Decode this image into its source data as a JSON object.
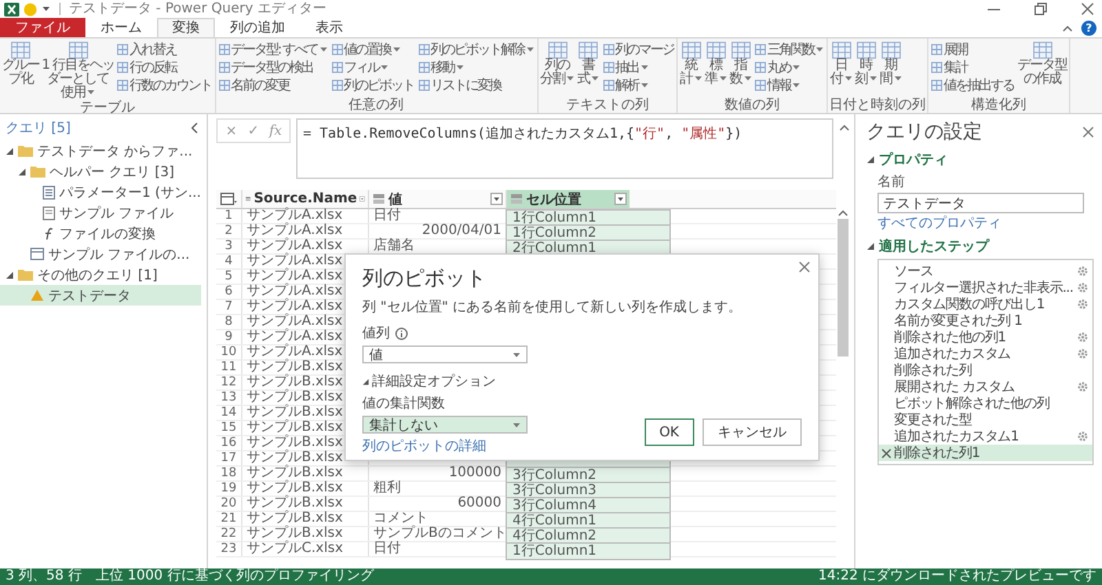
{
  "window": {
    "title": "テストデータ - Power Query エディター"
  },
  "tabs": [
    {
      "label": "ファイル",
      "kind": "file",
      "selected": false
    },
    {
      "label": "ホーム",
      "kind": "tab",
      "selected": false
    },
    {
      "label": "変換",
      "kind": "tab",
      "selected": true
    },
    {
      "label": "列の追加",
      "kind": "tab",
      "selected": false
    },
    {
      "label": "表示",
      "kind": "tab",
      "selected": false
    }
  ],
  "help": "?",
  "ribbon": {
    "groups": [
      {
        "label": "テーブル",
        "items": [
          {
            "kind": "large",
            "label": "グループ化",
            "menu": false
          },
          {
            "kind": "large",
            "label": "1 行目をヘッダーとして使用",
            "menu": true
          },
          {
            "kind": "stack",
            "items": [
              {
                "label": "入れ替え",
                "menu": false
              },
              {
                "label": "行の反転",
                "menu": false
              },
              {
                "label": "行数のカウント",
                "menu": false
              }
            ]
          }
        ]
      },
      {
        "label": "任意の列",
        "items": [
          {
            "kind": "stack",
            "items": [
              {
                "label": "データ型: すべて",
                "menu": true
              },
              {
                "label": "データ型の検出",
                "menu": false
              },
              {
                "label": "名前の変更",
                "menu": false
              }
            ]
          },
          {
            "kind": "stack",
            "items": [
              {
                "label": "値の置換",
                "menu": true
              },
              {
                "label": "フィル",
                "menu": true
              },
              {
                "label": "列のピボット",
                "menu": false
              }
            ]
          },
          {
            "kind": "stack",
            "items": [
              {
                "label": "列のピボット解除",
                "menu": true
              },
              {
                "label": "移動",
                "menu": true
              },
              {
                "label": "リストに変換",
                "menu": false
              }
            ]
          }
        ]
      },
      {
        "label": "テキストの列",
        "items": [
          {
            "kind": "large",
            "label": "列の分割",
            "menu": true
          },
          {
            "kind": "large",
            "label": "書式",
            "menu": true
          },
          {
            "kind": "stack",
            "items": [
              {
                "label": "列のマージ",
                "menu": false
              },
              {
                "label": "抽出",
                "menu": true
              },
              {
                "label": "解析",
                "menu": true
              }
            ]
          }
        ]
      },
      {
        "label": "数値の列",
        "items": [
          {
            "kind": "large",
            "label": "統計",
            "menu": true
          },
          {
            "kind": "large",
            "label": "標準",
            "menu": true
          },
          {
            "kind": "large",
            "label": "指数",
            "menu": true
          },
          {
            "kind": "stack",
            "items": [
              {
                "label": "三角関数",
                "menu": true
              },
              {
                "label": "丸め",
                "menu": true
              },
              {
                "label": "情報",
                "menu": true
              }
            ]
          }
        ]
      },
      {
        "label": "日付と時刻の列",
        "items": [
          {
            "kind": "large",
            "label": "日付",
            "menu": true
          },
          {
            "kind": "large",
            "label": "時刻",
            "menu": true
          },
          {
            "kind": "large",
            "label": "期間",
            "menu": true
          }
        ]
      },
      {
        "label": "構造化列",
        "items": [
          {
            "kind": "stack",
            "items": [
              {
                "label": "展開",
                "menu": false
              },
              {
                "label": "集計",
                "menu": false
              },
              {
                "label": "値を抽出する",
                "menu": false
              }
            ]
          },
          {
            "kind": "large",
            "label": "データ型の作成",
            "menu": false
          }
        ]
      }
    ]
  },
  "queries": {
    "title": "クエリ [5]",
    "tree": [
      {
        "label": "テストデータ からファ...",
        "kind": "folder",
        "expanded": true,
        "selected": false,
        "children": [
          {
            "label": "ヘルパー クエリ [3]",
            "kind": "folder",
            "expanded": true,
            "selected": false,
            "children": [
              {
                "label": "パラメーター1 (サン...",
                "kind": "parameter",
                "selected": false
              },
              {
                "label": "サンプル ファイル",
                "kind": "file",
                "selected": false
              },
              {
                "label": "ファイルの変換",
                "kind": "function",
                "selected": false
              }
            ]
          },
          {
            "label": "サンプル ファイルの...",
            "kind": "table",
            "selected": false
          }
        ]
      },
      {
        "label": "その他のクエリ [1]",
        "kind": "folder",
        "expanded": true,
        "selected": false,
        "children": [
          {
            "label": "テストデータ",
            "kind": "warning",
            "selected": true
          }
        ]
      }
    ]
  },
  "formula_bar": {
    "buttons": [
      "×",
      "✓",
      "fx"
    ],
    "tokens": [
      {
        "kind": "code",
        "text": "= Table.RemoveColumns(追加されたカスタム1,{"
      },
      {
        "kind": "string",
        "text": "\"行\""
      },
      {
        "kind": "code",
        "text": ", "
      },
      {
        "kind": "string",
        "text": "\"属性\""
      },
      {
        "kind": "code",
        "text": "})"
      }
    ]
  },
  "table": {
    "columns": [
      {
        "name": "Source.Name",
        "selected": false
      },
      {
        "name": "値",
        "selected": false
      },
      {
        "name": "セル位置",
        "selected": true
      }
    ],
    "rows": [
      {
        "n": "1",
        "source": "サンプルA.xlsx",
        "value": {
          "text": "日付",
          "kind": "text"
        },
        "cell": "1行Column1"
      },
      {
        "n": "2",
        "source": "サンプルA.xlsx",
        "value": {
          "text": "2000/04/01",
          "kind": "number"
        },
        "cell": "1行Column2"
      },
      {
        "n": "3",
        "source": "サンプルA.xlsx",
        "value": {
          "text": "店舗名",
          "kind": "text"
        },
        "cell": "2行Column1"
      },
      {
        "n": "4",
        "source": "サンプルA.xlsx"
      },
      {
        "n": "5",
        "source": "サンプルA.xlsx"
      },
      {
        "n": "6",
        "source": "サンプルA.xlsx"
      },
      {
        "n": "7",
        "source": "サンプルA.xlsx"
      },
      {
        "n": "8",
        "source": "サンプルA.xlsx"
      },
      {
        "n": "9",
        "source": "サンプルA.xlsx"
      },
      {
        "n": "10",
        "source": "サンプルA.xlsx"
      },
      {
        "n": "11",
        "source": "サンプルB.xlsx"
      },
      {
        "n": "12",
        "source": "サンプルB.xlsx"
      },
      {
        "n": "13",
        "source": "サンプルB.xlsx"
      },
      {
        "n": "14",
        "source": "サンプルB.xlsx"
      },
      {
        "n": "15",
        "source": "サンプルB.xlsx"
      },
      {
        "n": "16",
        "source": "サンプルB.xlsx"
      },
      {
        "n": "17",
        "source": "サンプルB.xlsx"
      },
      {
        "n": "18",
        "source": "サンプルB.xlsx",
        "value": {
          "text": "100000",
          "kind": "number"
        },
        "cell": "3行Column2"
      },
      {
        "n": "19",
        "source": "サンプルB.xlsx",
        "value": {
          "text": "粗利",
          "kind": "text"
        },
        "cell": "3行Column3"
      },
      {
        "n": "20",
        "source": "サンプルB.xlsx",
        "value": {
          "text": "60000",
          "kind": "number"
        },
        "cell": "3行Column4"
      },
      {
        "n": "21",
        "source": "サンプルB.xlsx",
        "value": {
          "text": "コメント",
          "kind": "text"
        },
        "cell": "4行Column1"
      },
      {
        "n": "22",
        "source": "サンプルB.xlsx",
        "value": {
          "text": "サンプルBのコメント",
          "kind": "text"
        },
        "cell": "4行Column2"
      },
      {
        "n": "23",
        "source": "サンプルC.xlsx",
        "value": {
          "text": "日付",
          "kind": "text"
        },
        "cell": "1行Column1"
      }
    ]
  },
  "dialog": {
    "title": "列のピボット",
    "description": "列 \"セル位置\" にある名前を使用して新しい列を作成します。",
    "values_label": "値列",
    "values_select": "値",
    "advanced": {
      "label": "詳細設定オプション",
      "expanded": true
    },
    "aggregate_label": "値の集計関数",
    "aggregate_select": {
      "value": "集計しない",
      "highlighted": true
    },
    "link": "列のピボットの詳細",
    "buttons": [
      {
        "label": "OK",
        "kind": "primary"
      },
      {
        "label": "キャンセル",
        "kind": "secondary"
      }
    ]
  },
  "settings": {
    "title": "クエリの設定",
    "properties": {
      "label": "プロパティ",
      "expanded": true,
      "name_label": "名前",
      "name": "テストデータ",
      "link": "すべてのプロパティ"
    },
    "steps_section": {
      "label": "適用したステップ",
      "expanded": true
    },
    "steps": [
      {
        "label": "ソース",
        "gear": true,
        "selected": false
      },
      {
        "label": "フィルター選択された非表示...",
        "gear": true,
        "selected": false
      },
      {
        "label": "カスタム関数の呼び出し1",
        "gear": true,
        "selected": false
      },
      {
        "label": "名前が変更された列 1",
        "gear": false,
        "selected": false
      },
      {
        "label": "削除された他の列1",
        "gear": true,
        "selected": false
      },
      {
        "label": "追加されたカスタム",
        "gear": true,
        "selected": false
      },
      {
        "label": "削除された列",
        "gear": false,
        "selected": false
      },
      {
        "label": "展開された カスタム",
        "gear": true,
        "selected": false
      },
      {
        "label": "ピボット解除された他の列",
        "gear": false,
        "selected": false
      },
      {
        "label": "変更された型",
        "gear": false,
        "selected": false
      },
      {
        "label": "追加されたカスタム1",
        "gear": true,
        "selected": false
      },
      {
        "label": "削除された列1",
        "gear": false,
        "selected": true
      }
    ]
  },
  "status_bar": {
    "left": [
      "3 列、58 行",
      "上位 1000 行に基づく列のプロファイリング"
    ],
    "right": "14:22 にダウンロードされたプレビューです"
  }
}
